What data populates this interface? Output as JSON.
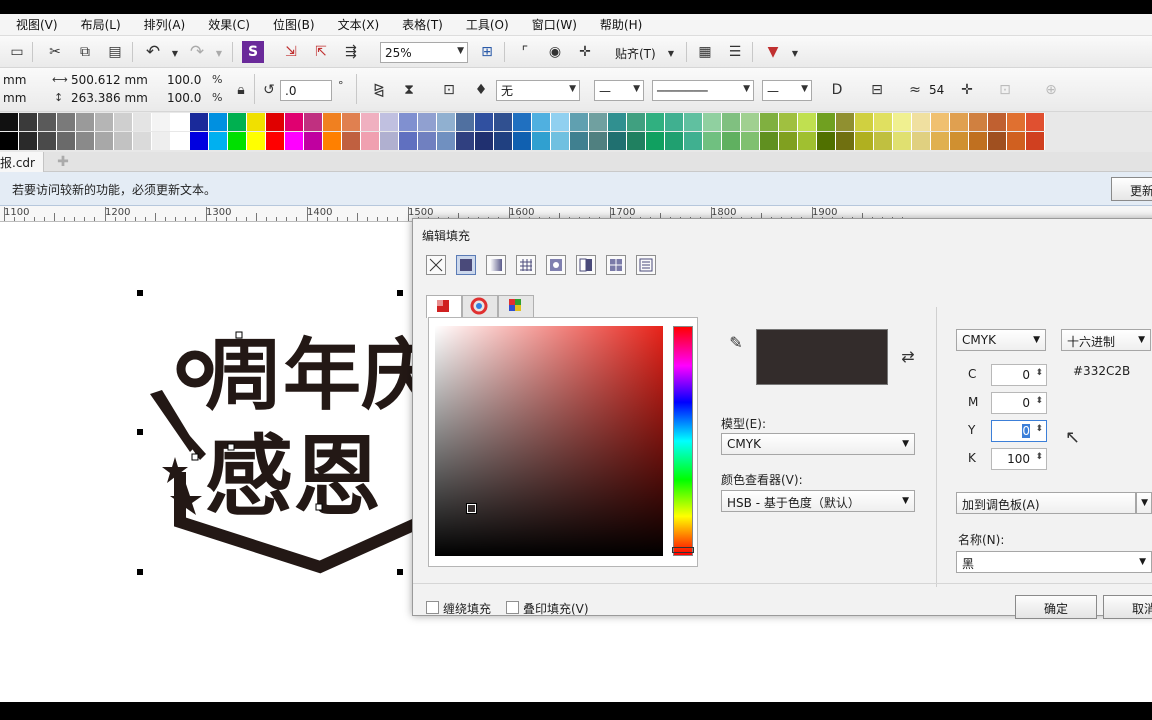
{
  "menubar": {
    "items": [
      "视图(V)",
      "布局(L)",
      "排列(A)",
      "效果(C)",
      "位图(B)",
      "文本(X)",
      "表格(T)",
      "工具(O)",
      "窗口(W)",
      "帮助(H)"
    ],
    "first_partial": "视图(V)"
  },
  "toolbar": {
    "zoom": "25%",
    "snap_label": "贴齐(T)",
    "undo_icon": "undo-icon"
  },
  "propertybar": {
    "x_unit": "mm",
    "y_unit": "mm",
    "width": "500.612 mm",
    "height": "263.386 mm",
    "scale_w": "100.0",
    "scale_h": "100.0",
    "pct": "%",
    "rotation": ".0",
    "degree": "°",
    "outline": "无",
    "miter": "54"
  },
  "palette": {
    "row1": [
      "#111111",
      "#3a3a3a",
      "#5a5a5a",
      "#7a7a7a",
      "#9a9a9a",
      "#b5b5b5",
      "#cfcfcf",
      "#e4e4e4",
      "#f4f4f4",
      "#ffffff",
      "#1a2a9a",
      "#0090e0",
      "#00b050",
      "#f0e000",
      "#e00000",
      "#e00070",
      "#c03080",
      "#f08020",
      "#e08050",
      "#f0b0c0",
      "#c0c0e0",
      "#8090d0",
      "#90a0d0",
      "#90b0d0",
      "#5070a0",
      "#3050a0",
      "#305090",
      "#2070c0",
      "#50b0e0",
      "#90d0f0",
      "#60a0b0",
      "#70a0a0",
      "#309090",
      "#40a080",
      "#30b080",
      "#40b090",
      "#60c0a0",
      "#90d0a0",
      "#80c080",
      "#a0d090",
      "#80b040",
      "#a0c040",
      "#c0e050",
      "#70a020",
      "#909030",
      "#d0d040",
      "#e0e060",
      "#f0f090",
      "#f0e0a0",
      "#f0c070",
      "#e0a050",
      "#d08040",
      "#c06030",
      "#e07030",
      "#e05030"
    ],
    "row2": [
      "#000000",
      "#2a2a2a",
      "#4a4a4a",
      "#6a6a6a",
      "#8a8a8a",
      "#a8a8a8",
      "#c2c2c2",
      "#dadada",
      "#eeeeee",
      "#ffffff",
      "#0000e0",
      "#00b0f0",
      "#00e000",
      "#ffff00",
      "#ff0000",
      "#ff00ff",
      "#c000a0",
      "#ff8000",
      "#c06040",
      "#f0a0b0",
      "#b0b0d0",
      "#6070c0",
      "#7080c0",
      "#7090c0",
      "#304080",
      "#203070",
      "#204080",
      "#1060b0",
      "#30a0d0",
      "#70c0e0",
      "#408090",
      "#508080",
      "#207070",
      "#208060",
      "#10a060",
      "#20a070",
      "#40b090",
      "#70c080",
      "#60b060",
      "#80c070",
      "#609020",
      "#80a020",
      "#a0c030",
      "#507000",
      "#707010",
      "#b0b020",
      "#c0c040",
      "#e0e070",
      "#e0d080",
      "#e0b050",
      "#d09030",
      "#c07020",
      "#a05020",
      "#d06020",
      "#d04020"
    ]
  },
  "document": {
    "tab_name": "报.cdr"
  },
  "infobar": {
    "message": "若要访问较新的功能，必须更新文本。",
    "update_button": "更新"
  },
  "ruler": {
    "labels": [
      "1100",
      "1200",
      "1300",
      "1400",
      "1500",
      "1600",
      "1700",
      "1800",
      "1900"
    ]
  },
  "artwork": {
    "line1": "周年庆",
    "line2": "感恩"
  },
  "dialog": {
    "title": "编辑填充",
    "fill_types": [
      "no-fill-icon",
      "uniform-fill-icon",
      "fountain-fill-icon",
      "vector-pattern-icon",
      "bitmap-pattern-icon",
      "two-color-pattern-icon",
      "texture-fill-icon",
      "postscript-fill-icon"
    ],
    "subtabs": [
      "color-viewers-tab",
      "color-harmonies-tab",
      "color-palettes-tab"
    ],
    "preview_color": "#332C2B",
    "model_label": "模型(E):",
    "model_value": "CMYK",
    "viewer_label": "颜色查看器(V):",
    "viewer_value": "HSB - 基于色度（默认）",
    "color_model": "CMYK",
    "hex_mode": "十六进制",
    "hex_value": "#332C2B",
    "cmyk": [
      {
        "label": "C",
        "value": "0"
      },
      {
        "label": "M",
        "value": "0"
      },
      {
        "label": "Y",
        "value": "0"
      },
      {
        "label": "K",
        "value": "100"
      }
    ],
    "add_palette": "加到调色板(A)",
    "name_label": "名称(N):",
    "name_value": "黑",
    "wrap_fill": "缠绕填充",
    "overprint_fill": "叠印填充(V)",
    "ok": "确定",
    "cancel": "取消"
  }
}
